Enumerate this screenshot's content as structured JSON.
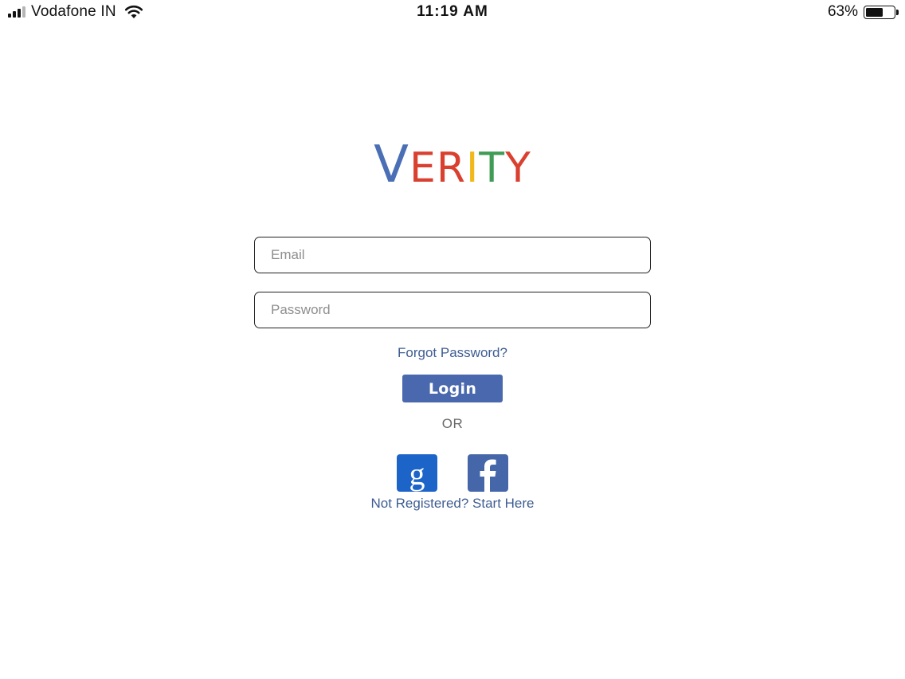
{
  "status_bar": {
    "carrier": "Vodafone IN",
    "time": "11:19 AM",
    "battery_percent": "63%",
    "battery_level": 0.63,
    "signal_bars": 3,
    "signal_bars_total": 4
  },
  "logo": {
    "letters": [
      "V",
      "E",
      "R",
      "I",
      "T",
      "Y"
    ],
    "colors": [
      "#4a6fb5",
      "#d9402f",
      "#d9402f",
      "#f1b81a",
      "#3f9b55",
      "#d9402f"
    ]
  },
  "form": {
    "email_placeholder": "Email",
    "email_value": "",
    "password_placeholder": "Password",
    "password_value": ""
  },
  "links": {
    "forgot_password": "Forgot Password?",
    "register": "Not Registered? Start Here"
  },
  "login_button": {
    "label": "Login",
    "color": "#4a68ae"
  },
  "divider": {
    "or_label": "OR"
  },
  "social": {
    "google_icon": "google-icon",
    "facebook_icon": "facebook-icon",
    "google_color": "#1c64c8",
    "facebook_color": "#4566a8"
  }
}
